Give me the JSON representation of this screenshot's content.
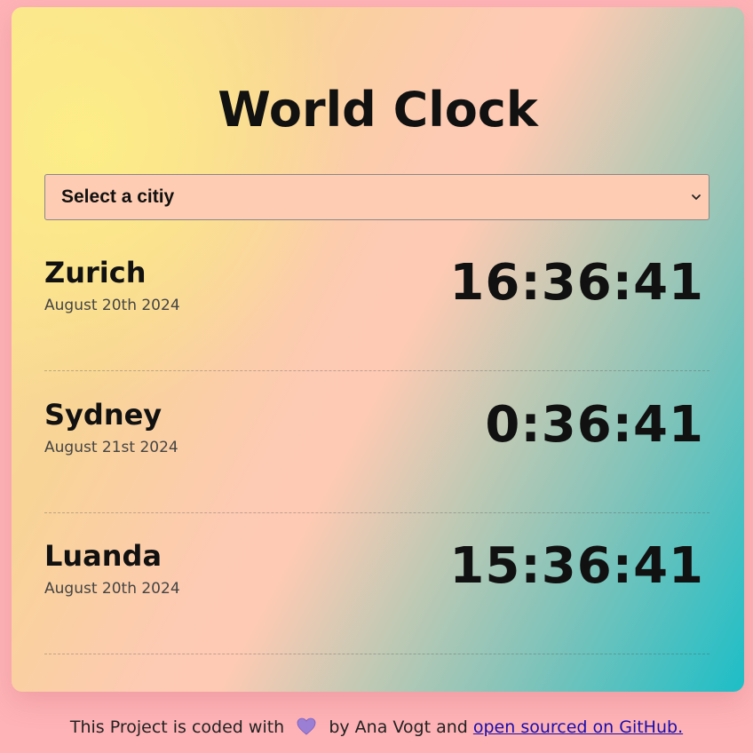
{
  "app": {
    "title": "World Clock"
  },
  "city_select": {
    "selected": "Select a citiy"
  },
  "cities": [
    {
      "name": "Zurich",
      "date": "August 20th 2024",
      "time": "16:36:41"
    },
    {
      "name": "Sydney",
      "date": "August 21st 2024",
      "time": "0:36:41"
    },
    {
      "name": "Luanda",
      "date": "August 20th 2024",
      "time": "15:36:41"
    }
  ],
  "footer": {
    "text_before": "This Project is coded with",
    "heart_icon": "purple-heart-icon",
    "text_middle": "by Ana Vogt and",
    "link_text": "open sourced on GitHub."
  },
  "colors": {
    "page_background": "#feb3b6",
    "select_background": "#feccb2",
    "link": "#1a0dab"
  }
}
